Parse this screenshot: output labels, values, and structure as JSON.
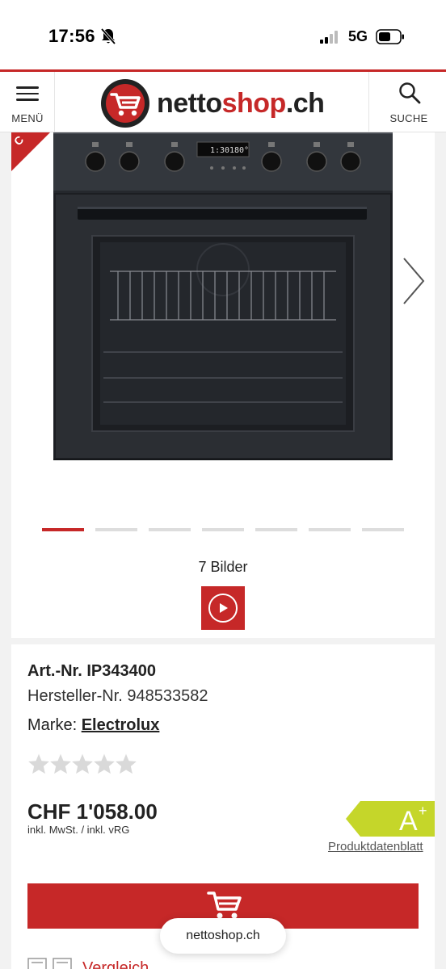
{
  "status_bar": {
    "time": "17:56",
    "network": "5G",
    "icons": [
      "bell-slash-icon",
      "signal-icon",
      "battery-icon"
    ]
  },
  "header": {
    "menu_label": "MENÜ",
    "logo_prefix": "netto",
    "logo_accent": "shop",
    "logo_suffix": ".ch",
    "search_label": "SUCHE",
    "accent_color": "#c62828"
  },
  "gallery": {
    "badge_text": "C",
    "image_count_label": "7 Bilder",
    "total_images": 7,
    "active_image": 1,
    "oven_display": {
      "time": "1:30",
      "temperature": "180°"
    }
  },
  "product": {
    "art_nr": "Art.-Nr. IP343400",
    "hersteller_nr": "Hersteller-Nr. 948533582",
    "brand_label": "Marke:",
    "brand_name": "Electrolux",
    "rating_stars": 0,
    "rating_max": 5,
    "price": "CHF 1'058.00",
    "price_note": "inkl. MwSt. / inkl. vRG",
    "energy_class": "A",
    "energy_class_sup": "+",
    "energy_color": "#c5d62a",
    "datasheet_link": "Produktdatenblatt",
    "compare_label": "Vergleich"
  },
  "browser": {
    "url": "nettoshop.ch"
  }
}
